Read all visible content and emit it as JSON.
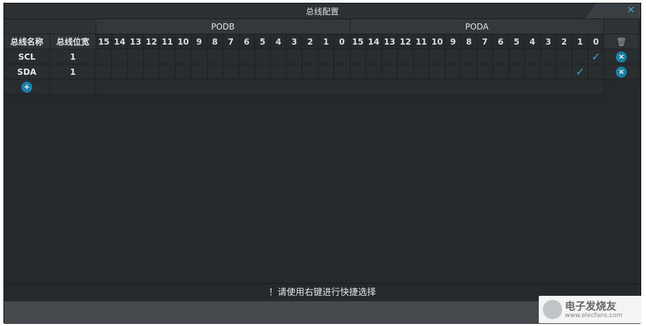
{
  "window": {
    "title": "总线配置",
    "close_icon": "close-icon"
  },
  "table": {
    "col_name": "总线名称",
    "col_width": "总线位宽",
    "group_b": "PODB",
    "group_a": "PODA",
    "bits_b": [
      "15",
      "14",
      "13",
      "12",
      "11",
      "10",
      "9",
      "8",
      "7",
      "6",
      "5",
      "4",
      "3",
      "2",
      "1",
      "0"
    ],
    "bits_a": [
      "15",
      "14",
      "13",
      "12",
      "11",
      "10",
      "9",
      "8",
      "7",
      "6",
      "5",
      "4",
      "3",
      "2",
      "1",
      "0"
    ],
    "rows": [
      {
        "name": "SCL",
        "width": "1",
        "checked": "PODA-0"
      },
      {
        "name": "SDA",
        "width": "1",
        "checked": "PODA-1"
      }
    ],
    "add_icon": "plus-icon",
    "delete_icon": "trash-icon",
    "remove_icon": "remove-icon"
  },
  "hint": "！请使用右键进行快捷选择",
  "watermark": {
    "text": "电子发烧友",
    "url": "www.elecfans.com"
  },
  "colors": {
    "accent": "#1b7fa8",
    "check": "#3aa3c7",
    "bg": "#26292c"
  }
}
